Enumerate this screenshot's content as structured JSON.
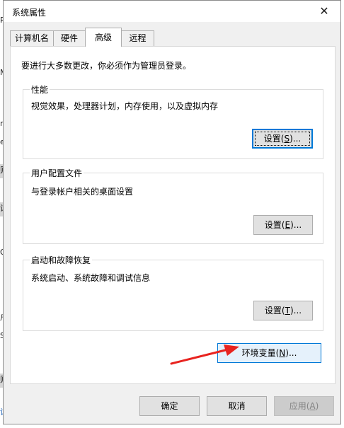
{
  "background_fragments": [
    "R",
    "M",
    "r",
    "e",
    "则",
    "设",
    "OV",
    "户",
    "SP",
    "则",
    "设"
  ],
  "dialog": {
    "title": "系统属性",
    "close_icon": "✕"
  },
  "tabs": [
    {
      "label": "计算机名",
      "active": false
    },
    {
      "label": "硬件",
      "active": false
    },
    {
      "label": "高级",
      "active": true
    },
    {
      "label": "远程",
      "active": false
    }
  ],
  "intro_text": "要进行大多数更改，你必须作为管理员登录。",
  "groups": {
    "performance": {
      "label": "性能",
      "description": "视觉效果，处理器计划，内存使用，以及虚拟内存",
      "button": {
        "text": "设置(",
        "key": "S",
        "suffix": ")..."
      }
    },
    "user_profiles": {
      "label": "用户配置文件",
      "description": "与登录帐户相关的桌面设置",
      "button": {
        "text": "设置(",
        "key": "E",
        "suffix": ")..."
      }
    },
    "startup_recovery": {
      "label": "启动和故障恢复",
      "description": "系统启动、系统故障和调试信息",
      "button": {
        "text": "设置(",
        "key": "T",
        "suffix": ")..."
      }
    }
  },
  "env_button": {
    "text": "环境变量(",
    "key": "N",
    "suffix": ")..."
  },
  "footer": {
    "ok": "确定",
    "cancel": "取消",
    "apply": {
      "text": "应用(",
      "key": "A",
      "suffix": ")"
    }
  },
  "colors": {
    "accent": "#0078d7",
    "annotation_arrow": "#e8231f"
  },
  "icons": [
    "close-icon",
    "annotation-arrow-icon"
  ]
}
